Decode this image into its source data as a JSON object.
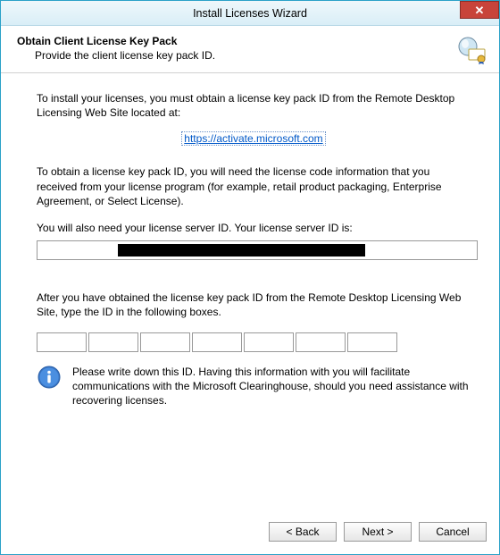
{
  "window": {
    "title": "Install Licenses Wizard",
    "close_glyph": "✕"
  },
  "header": {
    "title": "Obtain Client License Key Pack",
    "subtitle": "Provide the client license key pack ID."
  },
  "body": {
    "para_intro": "To install your licenses, you must obtain a license key pack ID from the Remote Desktop Licensing Web Site located at:",
    "link_text": "https://activate.microsoft.com",
    "para_need": "To obtain a license key pack ID, you will need the license code information that you received from your license program (for example, retail product packaging, Enterprise Agreement, or Select License).",
    "para_server_id": "You will also need your license server ID. Your license server ID is:",
    "server_id_value": "",
    "para_after": "After you have obtained the license key pack ID from the Remote Desktop Licensing Web Site, type the ID in the following boxes.",
    "kp_values": [
      "",
      "",
      "",
      "",
      "",
      "",
      ""
    ],
    "info_text": "Please write down this ID. Having this information with you will facilitate communications with the Microsoft Clearinghouse, should you need assistance with recovering licenses."
  },
  "footer": {
    "back": "< Back",
    "next": "Next >",
    "cancel": "Cancel"
  }
}
